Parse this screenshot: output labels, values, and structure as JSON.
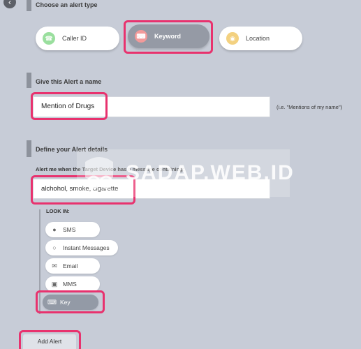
{
  "sections": {
    "alert_type_title": "Choose an alert type",
    "name_title": "Give this Alert a name",
    "details_title": "Define your Alert details"
  },
  "alert_types": [
    {
      "label": "Caller ID",
      "icon": "phone-icon",
      "color": "#9adf9e"
    },
    {
      "label": "Keyword",
      "icon": "keyboard-icon",
      "color": "#f29a9a",
      "active": true
    },
    {
      "label": "Location",
      "icon": "location-pin-icon",
      "color": "#f3d180"
    }
  ],
  "alert_name": {
    "value": "Mention of Drugs",
    "hint": "(i.e. \"Mentions of my name\")"
  },
  "details": {
    "lead": "Alert me when the Target Device has a message containing:",
    "keywords_value": "alchohol, smoke, cigarette",
    "look_in_label": "LOOK IN:",
    "sources": [
      {
        "label": "SMS",
        "icon": "speech-bubble-icon"
      },
      {
        "label": "Instant Messages",
        "icon": "chat-bubbles-icon"
      },
      {
        "label": "Email",
        "icon": "envelope-icon"
      },
      {
        "label": "MMS",
        "icon": "image-icon"
      },
      {
        "label": "Key",
        "icon": "keyboard-icon",
        "selected": true
      }
    ]
  },
  "add_alert_label": "Add Alert",
  "watermark": "SADAP.WEB.ID"
}
